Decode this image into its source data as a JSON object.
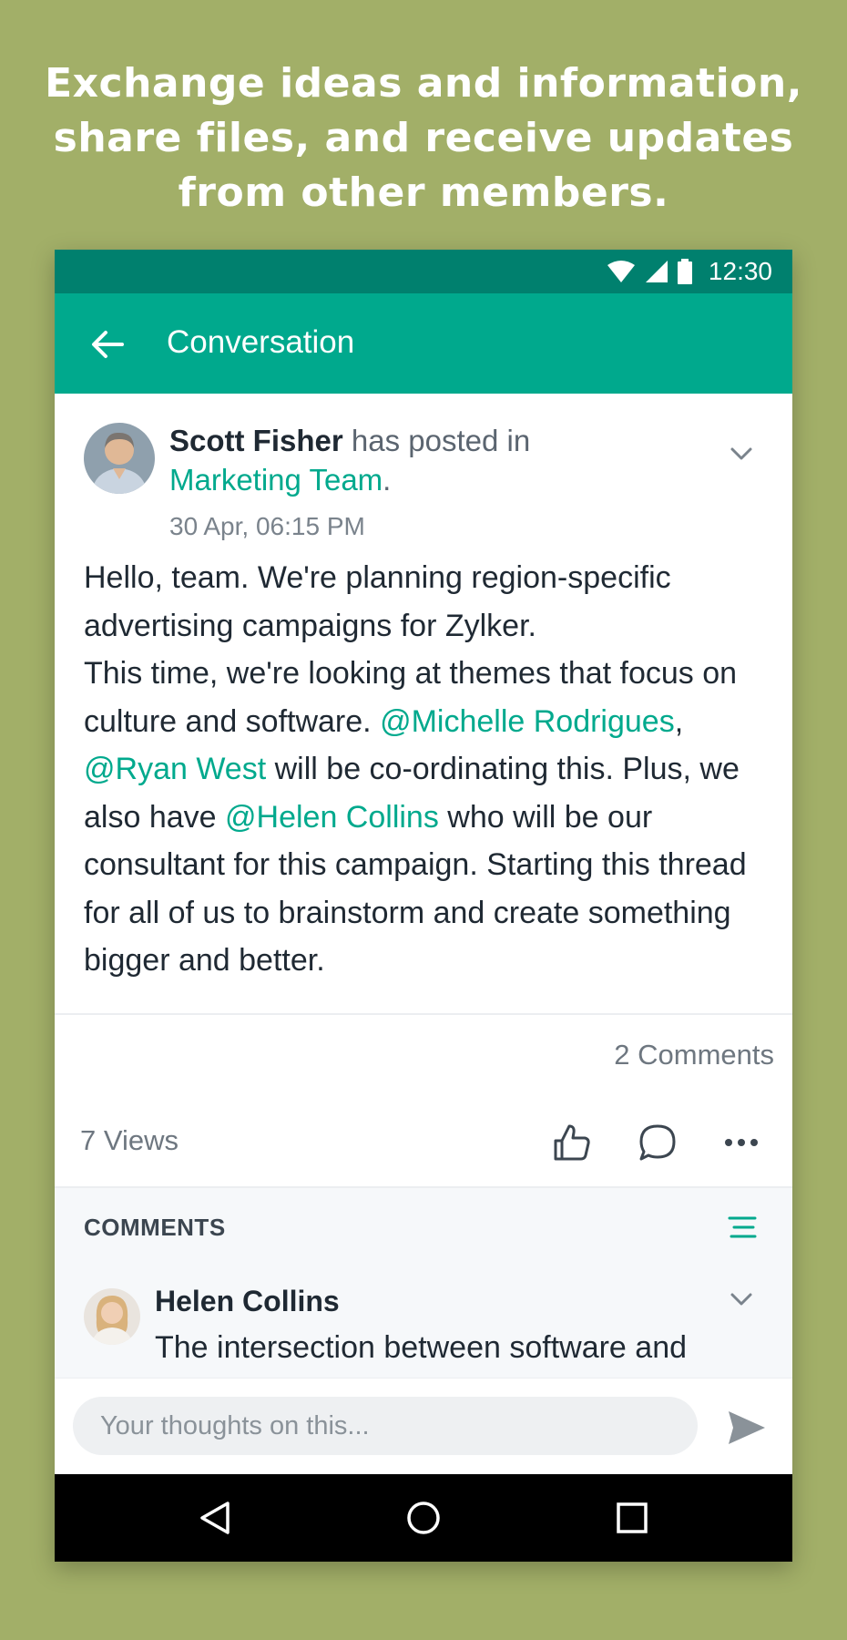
{
  "headline": {
    "line1": "Exchange ideas and information,",
    "line2": "share files, and receive updates",
    "line3": "from other members."
  },
  "status_bar": {
    "time": "12:30",
    "icons": [
      "wifi-icon",
      "signal-icon",
      "battery-icon"
    ]
  },
  "app_bar": {
    "title": "Conversation",
    "back_icon": "arrow-left-icon"
  },
  "post": {
    "author": "Scott Fisher",
    "posted_in_text": " has posted in",
    "team": "Marketing Team",
    "team_suffix": ".",
    "timestamp": "30 Apr, 06:15 PM",
    "body": {
      "p1": "Hello, team. We're planning region-specific advertising campaigns for Zylker.",
      "p2_a": "This time, we're looking at themes that focus on culture and software. ",
      "mention1": "@Michelle Rodrigues",
      "comma": ",",
      "mention2": "@Ryan West",
      "p2_b": " will be co-ordinating this. Plus, we also have ",
      "mention3": "@Helen Collins",
      "p2_c": " who will be our consultant for this campaign. Starting this thread for all of us to brainstorm and create something bigger and better."
    },
    "comments_count": "2 Comments",
    "views": "7 Views"
  },
  "comments": {
    "heading": "COMMENTS",
    "items": [
      {
        "author": "Helen Collins",
        "text": "The intersection between software and"
      }
    ]
  },
  "composer": {
    "placeholder": "Your thoughts on this..."
  },
  "colors": {
    "background": "#a2af68",
    "status_bar": "#00806e",
    "app_bar": "#00a98d",
    "accent": "#00a98d"
  }
}
